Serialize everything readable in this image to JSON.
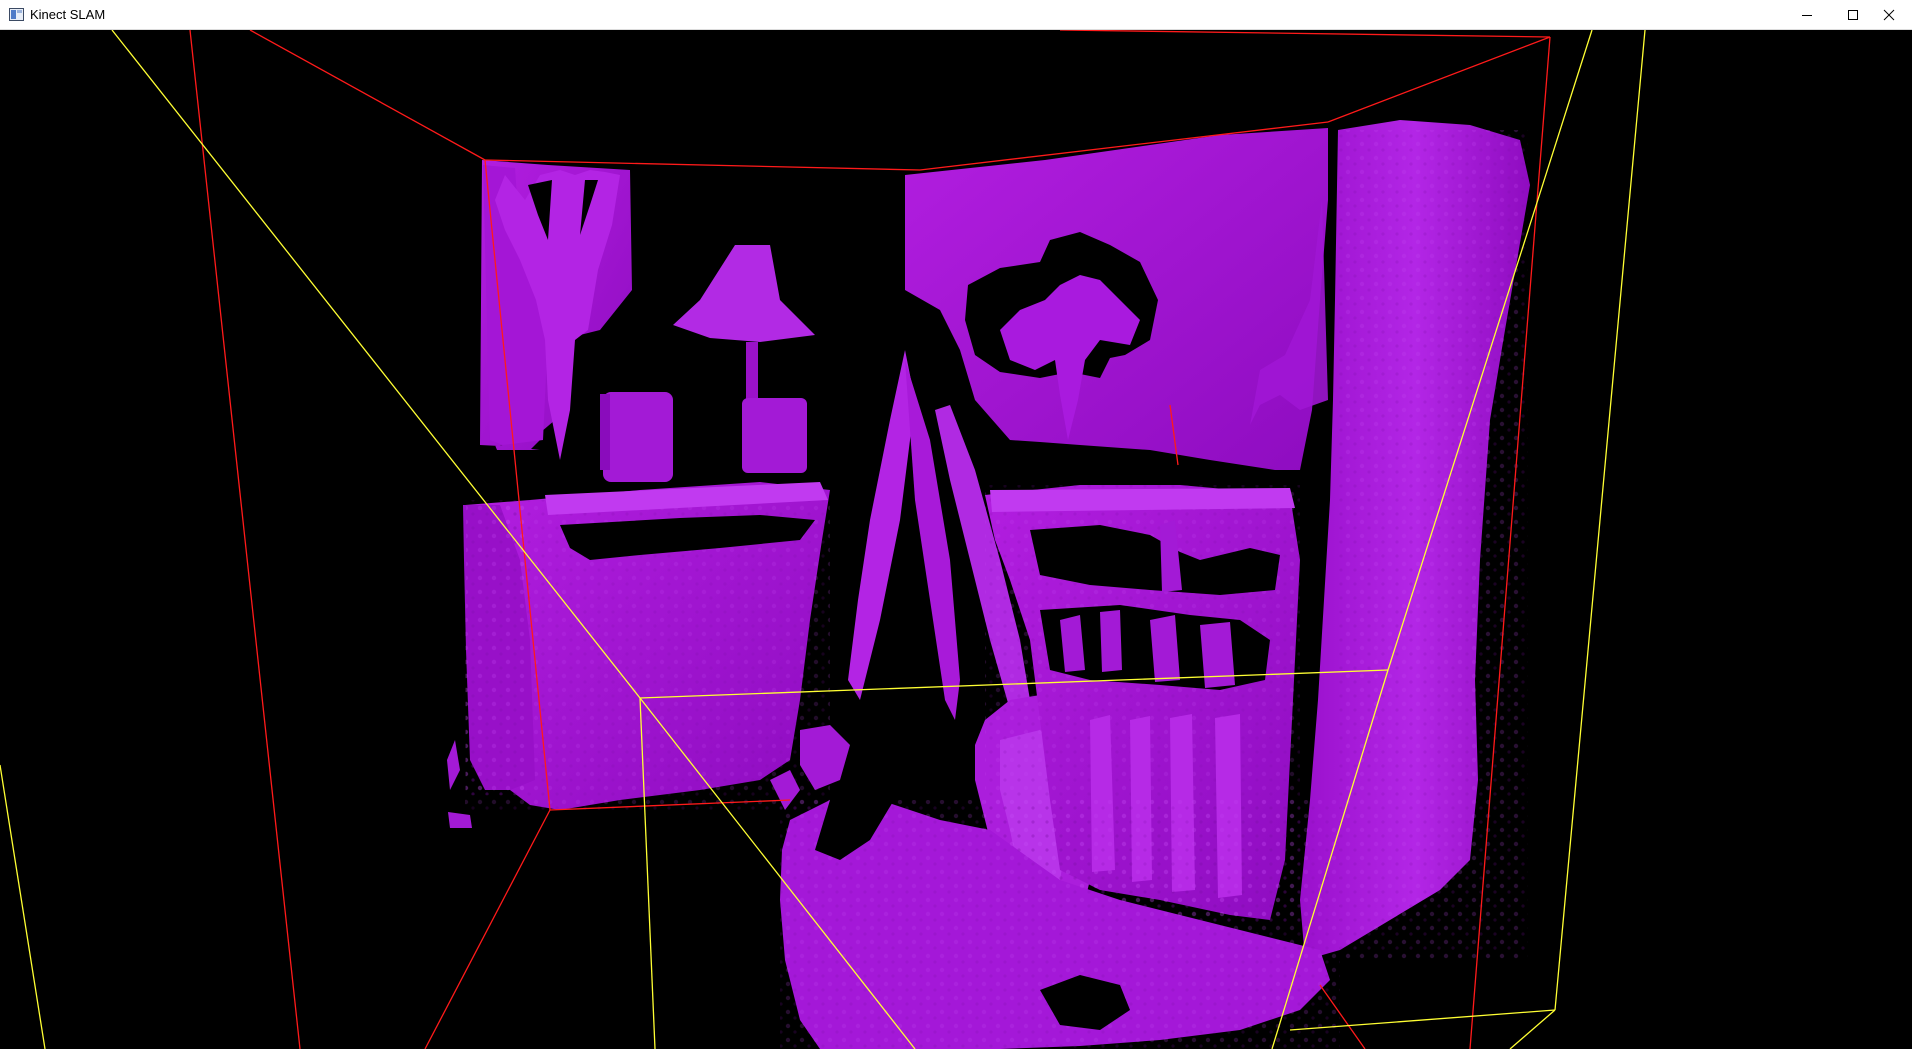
{
  "window": {
    "title": "Kinect SLAM",
    "icon": "app-window-icon",
    "controls": {
      "minimize": "minimize-icon",
      "maximize": "maximize-icon",
      "close": "close-icon"
    }
  },
  "scene": {
    "background_color": "#000000",
    "mesh_color": "#a010d0",
    "mesh_highlight_color": "#c040f0",
    "volume_bounds_color": "#ff1a1a",
    "camera_frustum_color": "#ffff33"
  }
}
